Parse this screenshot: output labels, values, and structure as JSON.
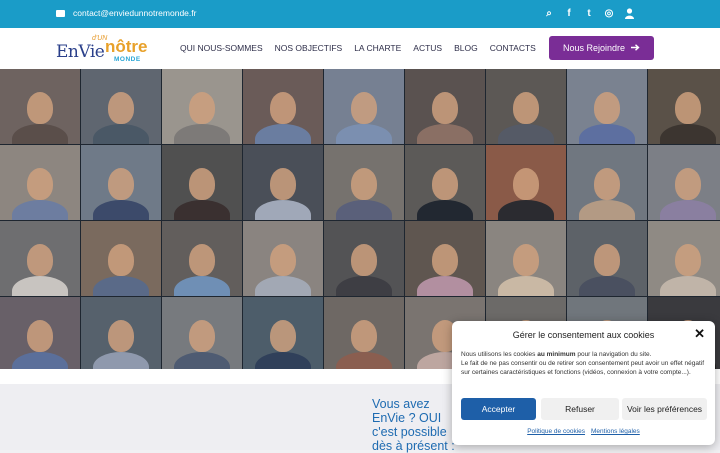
{
  "topbar": {
    "email": "contact@enviedunnotremonde.fr",
    "icons": [
      {
        "name": "search-icon",
        "glyph": "⌕"
      },
      {
        "name": "facebook-icon",
        "glyph": "f"
      },
      {
        "name": "twitter-icon",
        "glyph": "t"
      },
      {
        "name": "instagram-icon",
        "glyph": "◎"
      },
      {
        "name": "user-icon",
        "glyph": "👤"
      }
    ]
  },
  "logo": {
    "part1": "EnVie",
    "part2": "d'UN",
    "part3": "nôtre",
    "part4": "MONDE"
  },
  "nav": {
    "items": [
      "QUI NOUS-SOMMES",
      "NOS OBJECTIFS",
      "LA CHARTE",
      "ACTUS",
      "BLOG",
      "CONTACTS"
    ]
  },
  "cta": {
    "label": "Nous Rejoindre",
    "icon": "arrow-right-icon"
  },
  "hero": {
    "tiles": [
      {
        "bg": "#6e6360",
        "body": "#5a4e4a"
      },
      {
        "bg": "#5f6670",
        "body": "#4a5866"
      },
      {
        "bg": "#9a958e",
        "body": "#7d7a78"
      },
      {
        "bg": "#6a5b58",
        "body": "#6a7da0"
      },
      {
        "bg": "#768092",
        "body": "#7b8fb0"
      },
      {
        "bg": "#5a5250",
        "body": "#8a6f64"
      },
      {
        "bg": "#5c5855",
        "body": "#555a66"
      },
      {
        "bg": "#7a8290",
        "body": "#5d6fa0"
      },
      {
        "bg": "#5a5148",
        "body": "#3c3530"
      },
      {
        "bg": "#8d8680",
        "body": "#6d7da0"
      },
      {
        "bg": "#6f7a88",
        "body": "#3c4a6a"
      },
      {
        "bg": "#505050",
        "body": "#3a3030"
      },
      {
        "bg": "#4a4f58",
        "body": "#a0a8b8"
      },
      {
        "bg": "#76726e",
        "body": "#5a607a"
      },
      {
        "bg": "#5c5a58",
        "body": "#222831"
      },
      {
        "bg": "#8a5a48",
        "body": "#2b2b30"
      },
      {
        "bg": "#707780",
        "body": "#b39a84"
      },
      {
        "bg": "#7c7f86",
        "body": "#8a7fa0"
      },
      {
        "bg": "#6e6e70",
        "body": "#c8c4c0"
      },
      {
        "bg": "#7a6a5e",
        "body": "#5a6a88"
      },
      {
        "bg": "#625e5c",
        "body": "#6f8fb5"
      },
      {
        "bg": "#8a8480",
        "body": "#a2a8b4"
      },
      {
        "bg": "#535355",
        "body": "#3e3e44"
      },
      {
        "bg": "#5f5650",
        "body": "#b28fa0"
      },
      {
        "bg": "#8a8580",
        "body": "#c9b8a4"
      },
      {
        "bg": "#5d6268",
        "body": "#4a5060"
      },
      {
        "bg": "#8f8a84",
        "body": "#c0b4a8"
      },
      {
        "bg": "#686068",
        "body": "#5b6f9a"
      },
      {
        "bg": "#56616c",
        "body": "#8f99ad"
      },
      {
        "bg": "#777a7e",
        "body": "#4e5b72"
      },
      {
        "bg": "#4d5d6a",
        "body": "#30405a"
      },
      {
        "bg": "#6e6864",
        "body": "#8a5e50"
      },
      {
        "bg": "#7a7470",
        "body": "#bda6a0"
      },
      {
        "bg": "#6c6a68",
        "body": "#c8b8a8"
      },
      {
        "bg": "#70767c",
        "body": "#6a7890"
      },
      {
        "bg": "#3a3a3e",
        "body": "#222"
      }
    ]
  },
  "content": {
    "headline": "Vous avez EnVie ? OUI c'est possible dès à présent :"
  },
  "consent": {
    "title": "Gérer le consentement aux cookies",
    "close_icon": "close-icon",
    "text_pre": "Nous utilisons les cookies ",
    "text_bold": "au minimum",
    "text_post": " pour la navigation du site.",
    "text_line2": "Le fait de ne pas consentir ou de retirer son consentement peut avoir un effet négatif sur certaines caractéristiques et fonctions (vidéos, connexion à votre compte...).",
    "accept": "Accepter",
    "refuse": "Refuser",
    "preferences": "Voir les préférences",
    "link1": "Politique de cookies",
    "link2": "Mentions légales"
  }
}
